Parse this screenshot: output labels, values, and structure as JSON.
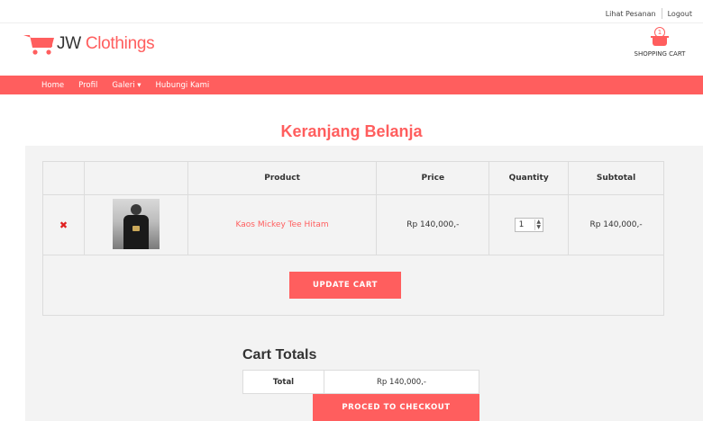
{
  "topbar": {
    "orders_link": "Lihat Pesanan",
    "logout_link": "Logout"
  },
  "brand": {
    "name_prefix": "JW",
    "name_accent": "Clothings"
  },
  "cart_widget": {
    "count": "1",
    "label": "SHOPPING CART"
  },
  "nav": {
    "items": [
      {
        "label": "Home"
      },
      {
        "label": "Profil"
      },
      {
        "label": "Galeri ▾"
      },
      {
        "label": "Hubungi Kami"
      }
    ]
  },
  "page": {
    "title": "Keranjang Belanja"
  },
  "cart_table": {
    "headers": {
      "remove": "",
      "thumbnail": "",
      "product": "Product",
      "price": "Price",
      "quantity": "Quantity",
      "subtotal": "Subtotal"
    },
    "rows": [
      {
        "remove_symbol": "✖",
        "product": "Kaos Mickey Tee Hitam",
        "price": "Rp 140,000,-",
        "quantity": "1",
        "subtotal": "Rp 140,000,-"
      }
    ],
    "update_button": "UPDATE CART"
  },
  "totals": {
    "title": "Cart Totals",
    "total_label": "Total",
    "total_value": "Rp 140,000,-",
    "checkout_button": "PROCED TO CHECKOUT"
  },
  "colors": {
    "accent": "#ff5e5e",
    "panel_bg": "#f3f3f3",
    "remove": "#e02020"
  },
  "icons": {
    "brand": "shopping-cart-icon",
    "cart_widget": "basket-icon",
    "remove": "close-icon",
    "quantity_spinner": "spinner-arrows-icon"
  }
}
